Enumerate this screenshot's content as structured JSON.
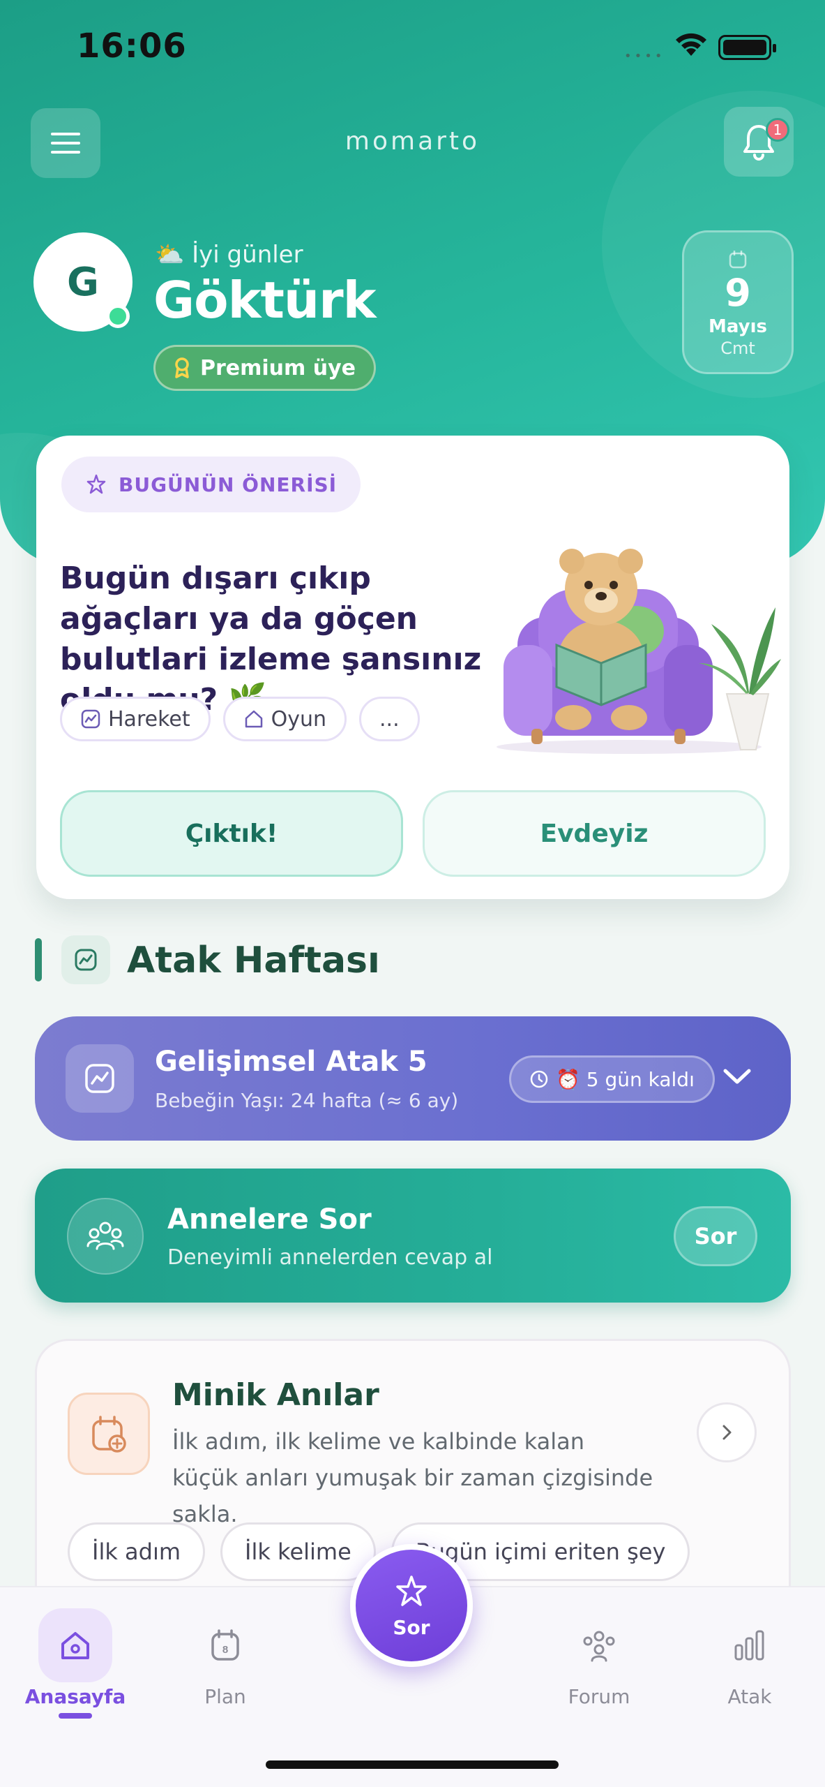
{
  "status_bar": {
    "time": "16:06",
    "signal_dots": "••••"
  },
  "header": {
    "brand": "momarto",
    "notification_count": "1",
    "greeting": "İyi günler",
    "greeting_icon": "partly-sunny-icon",
    "user_name": "Göktürk",
    "avatar_initial": "G",
    "membership": "Premium üye",
    "date": {
      "day": "9",
      "month": "Mayıs",
      "weekday": "Cmt"
    }
  },
  "suggestion": {
    "tag": "BUGÜNÜN ÖNERİSİ",
    "question": "Bugün dışarı çıkıp ağaçları ya da göçen bulutlari izleme şansınız oldu mu? 🌿",
    "chips": [
      "Hareket",
      "Oyun",
      "..."
    ],
    "primary_button": "Çıktık!",
    "secondary_button": "Evdeyiz"
  },
  "section": {
    "title": "Atak Haftası"
  },
  "atak_card": {
    "title": "Gelişimsel Atak 5",
    "subtitle": "Bebeğin Yaşı: 24 hafta (≈ 6 ay)",
    "badge": "⏰ 5 gün kaldı"
  },
  "ask_card": {
    "title": "Annelere Sor",
    "subtitle": "Deneyimli annelerden cevap al",
    "button": "Sor"
  },
  "memories_card": {
    "title": "Minik Anılar",
    "description": "İlk adım, ilk kelime ve kalbinde kalan küçük anları yumuşak bir zaman çizgisinde sakla.",
    "tags": [
      "İlk adım",
      "İlk kelime",
      "Bugün içimi eriten şey"
    ]
  },
  "bottom_nav": {
    "items": [
      {
        "label": "Anasayfa",
        "icon": "home-icon",
        "active": true
      },
      {
        "label": "Plan",
        "icon": "calendar-icon"
      },
      {
        "label": "Forum",
        "icon": "people-icon"
      },
      {
        "label": "Atak",
        "icon": "bar-chart-icon"
      }
    ],
    "fab_label": "Sor"
  },
  "colors": {
    "primary_teal": "#22a98f",
    "accent_purple": "#7a4fe0",
    "atak_indigo": "#6a6fd0"
  }
}
